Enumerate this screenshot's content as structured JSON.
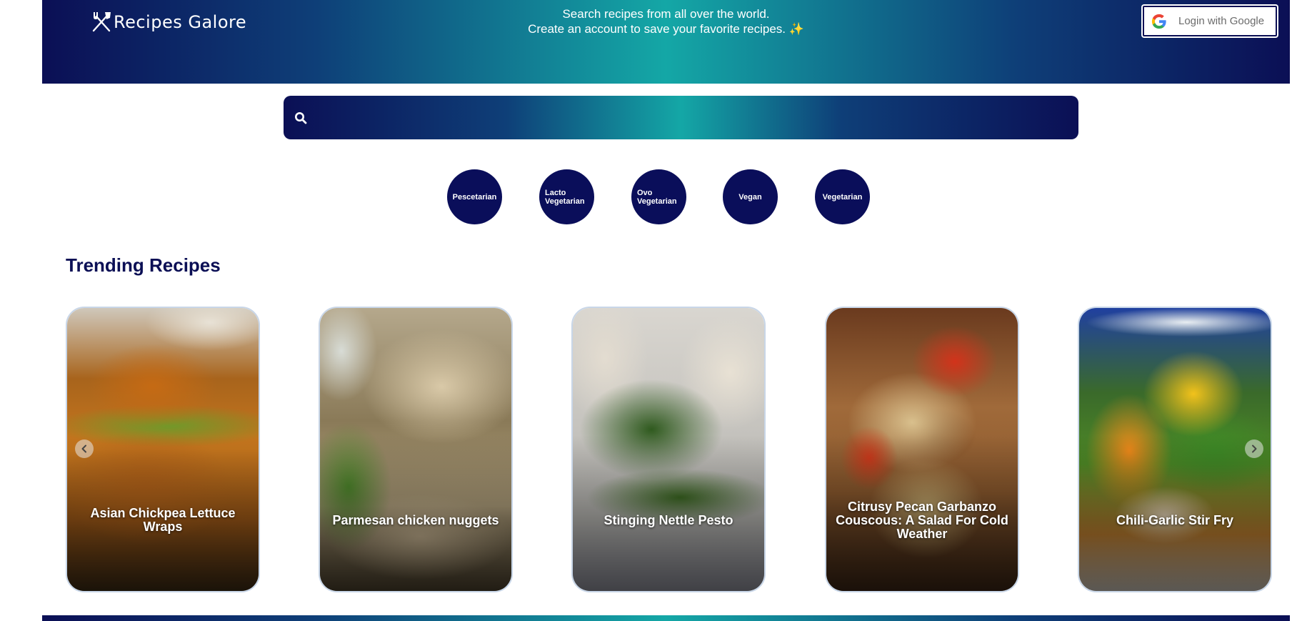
{
  "header": {
    "logo_text": "Recipes Galore",
    "tagline_line1": "Search recipes from all over the world.",
    "tagline_line2": "Create an account to save your favorite recipes. ✨",
    "login_label": "Login with Google"
  },
  "search": {
    "placeholder": "",
    "value": ""
  },
  "diets": [
    {
      "label": "Pescetarian"
    },
    {
      "label": "Lacto Vegetarian"
    },
    {
      "label": "Ovo Vegetarian"
    },
    {
      "label": "Vegan"
    },
    {
      "label": "Vegetarian"
    }
  ],
  "trending": {
    "title": "Trending Recipes",
    "cards": [
      {
        "title": "Asian Chickpea Lettuce Wraps"
      },
      {
        "title": "Parmesan chicken nuggets"
      },
      {
        "title": "Stinging Nettle Pesto"
      },
      {
        "title": "Citrusy Pecan Garbanzo Couscous: A Salad For Cold Weather"
      },
      {
        "title": "Chili-Garlic Stir Fry"
      }
    ]
  },
  "colors": {
    "brand_dark": "#0b0f55",
    "brand_teal": "#14a7a6",
    "diet_circle": "#0a0e5a"
  },
  "icons": {
    "logo": "fork-knife-icon",
    "login": "google-icon",
    "search": "search-icon",
    "prev": "chevron-left-icon",
    "next": "chevron-right-icon"
  }
}
